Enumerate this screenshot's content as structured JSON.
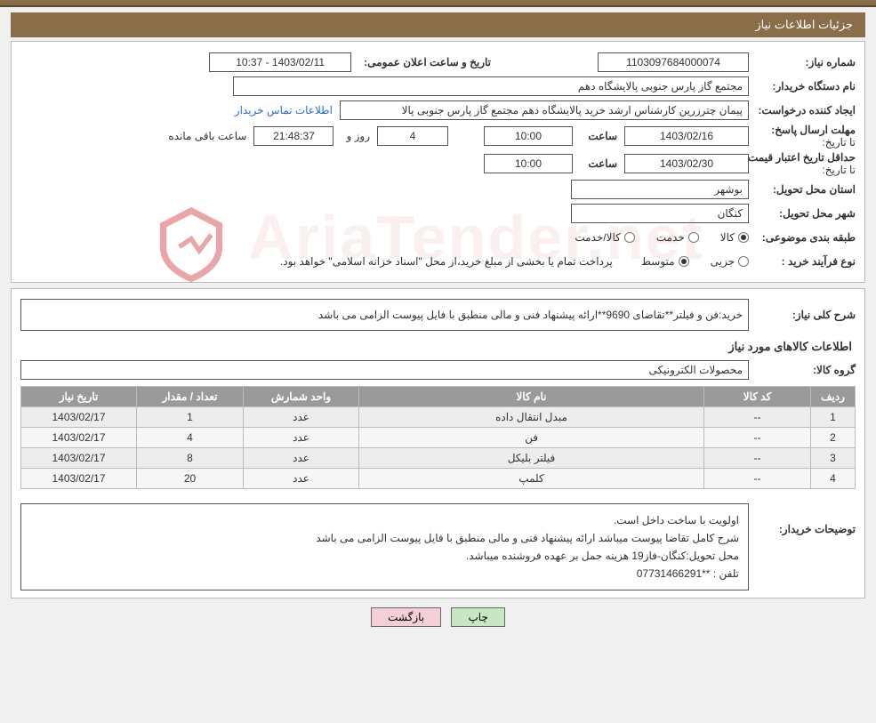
{
  "header": {
    "title": "جزئیات اطلاعات نیاز"
  },
  "info": {
    "need_number_label": "شماره نیاز:",
    "need_number": "1103097684000074",
    "announce_label": "تاریخ و ساعت اعلان عمومی:",
    "announce_value": "1403/02/11 - 10:37",
    "buyer_org_label": "نام دستگاه خریدار:",
    "buyer_org": "مجتمع گاز پارس جنوبی  پالایشگاه دهم",
    "creator_label": "ایجاد کننده درخواست:",
    "creator": "پیمان چترزرین کارشناس ارشد خرید پالایشگاه دهم مجتمع گاز پارس جنوبی  پالا",
    "contact_link": "اطلاعات تماس خریدار",
    "deadline_send_label": "مهلت ارسال پاسخ:",
    "to_date_label": "تا تاریخ:",
    "deadline_date": "1403/02/16",
    "time_label": "ساعت",
    "deadline_time": "10:00",
    "days_label": "روز و",
    "days_remaining": "4",
    "countdown": "21:48:37",
    "remaining_suffix": "ساعت باقی مانده",
    "price_validity_label": "حداقل تاریخ اعتبار قیمت:",
    "price_date": "1403/02/30",
    "price_time": "10:00",
    "delivery_province_label": "استان محل تحویل:",
    "delivery_province": "بوشهر",
    "delivery_city_label": "شهر محل تحویل:",
    "delivery_city": "کنگان",
    "category_label": "طبقه بندی موضوعی:",
    "category_goods": "کالا",
    "category_service": "خدمت",
    "category_goods_service": "کالا/خدمت",
    "process_label": "نوع فرآیند خرید :",
    "process_partial": "جزیی",
    "process_medium": "متوسط",
    "process_note": "پرداخت تمام یا بخشی از مبلغ خرید،از محل \"اسناد خزانه اسلامی\" خواهد بود."
  },
  "need": {
    "desc_label": "شرح کلی نیاز:",
    "desc": "خرید:فن و فیلتر**تقاضای 9690**ارائه پیشنهاد فنی و مالی منطبق با فایل پیوست الزامی می باشد",
    "goods_info_title": "اطلاعات کالاهای مورد نیاز",
    "group_label": "گروه کالا:",
    "group": "محصولات الکترونیکی",
    "cols": {
      "row": "ردیف",
      "code": "کد کالا",
      "name": "نام کالا",
      "unit": "واحد شمارش",
      "qty": "تعداد / مقدار",
      "date": "تاریخ نیاز"
    },
    "rows": [
      {
        "idx": "1",
        "code": "--",
        "name": "مبدل انتقال داده",
        "unit": "عدد",
        "qty": "1",
        "date": "1403/02/17"
      },
      {
        "idx": "2",
        "code": "--",
        "name": "فن",
        "unit": "عدد",
        "qty": "4",
        "date": "1403/02/17"
      },
      {
        "idx": "3",
        "code": "--",
        "name": "فیلتر بلیکل",
        "unit": "عدد",
        "qty": "8",
        "date": "1403/02/17"
      },
      {
        "idx": "4",
        "code": "--",
        "name": "کلمپ",
        "unit": "عدد",
        "qty": "20",
        "date": "1403/02/17"
      }
    ],
    "remarks_label": "توضیحات خریدار:",
    "remarks_l1": "اولویت با ساخت داخل است.",
    "remarks_l2": "شرح کامل تقاضا پیوست میباشد ارائه پیشنهاد فنی و مالی منطبق با فایل پیوست الزامی می باشد",
    "remarks_l3": "محل تحویل:کنگان-فاز19 هزینه حمل بر عهده فروشنده میباشد.",
    "remarks_l4": "تلفن : **07731466291"
  },
  "buttons": {
    "print": "چاپ",
    "back": "بازگشت"
  },
  "watermark": "AriaTender.net"
}
